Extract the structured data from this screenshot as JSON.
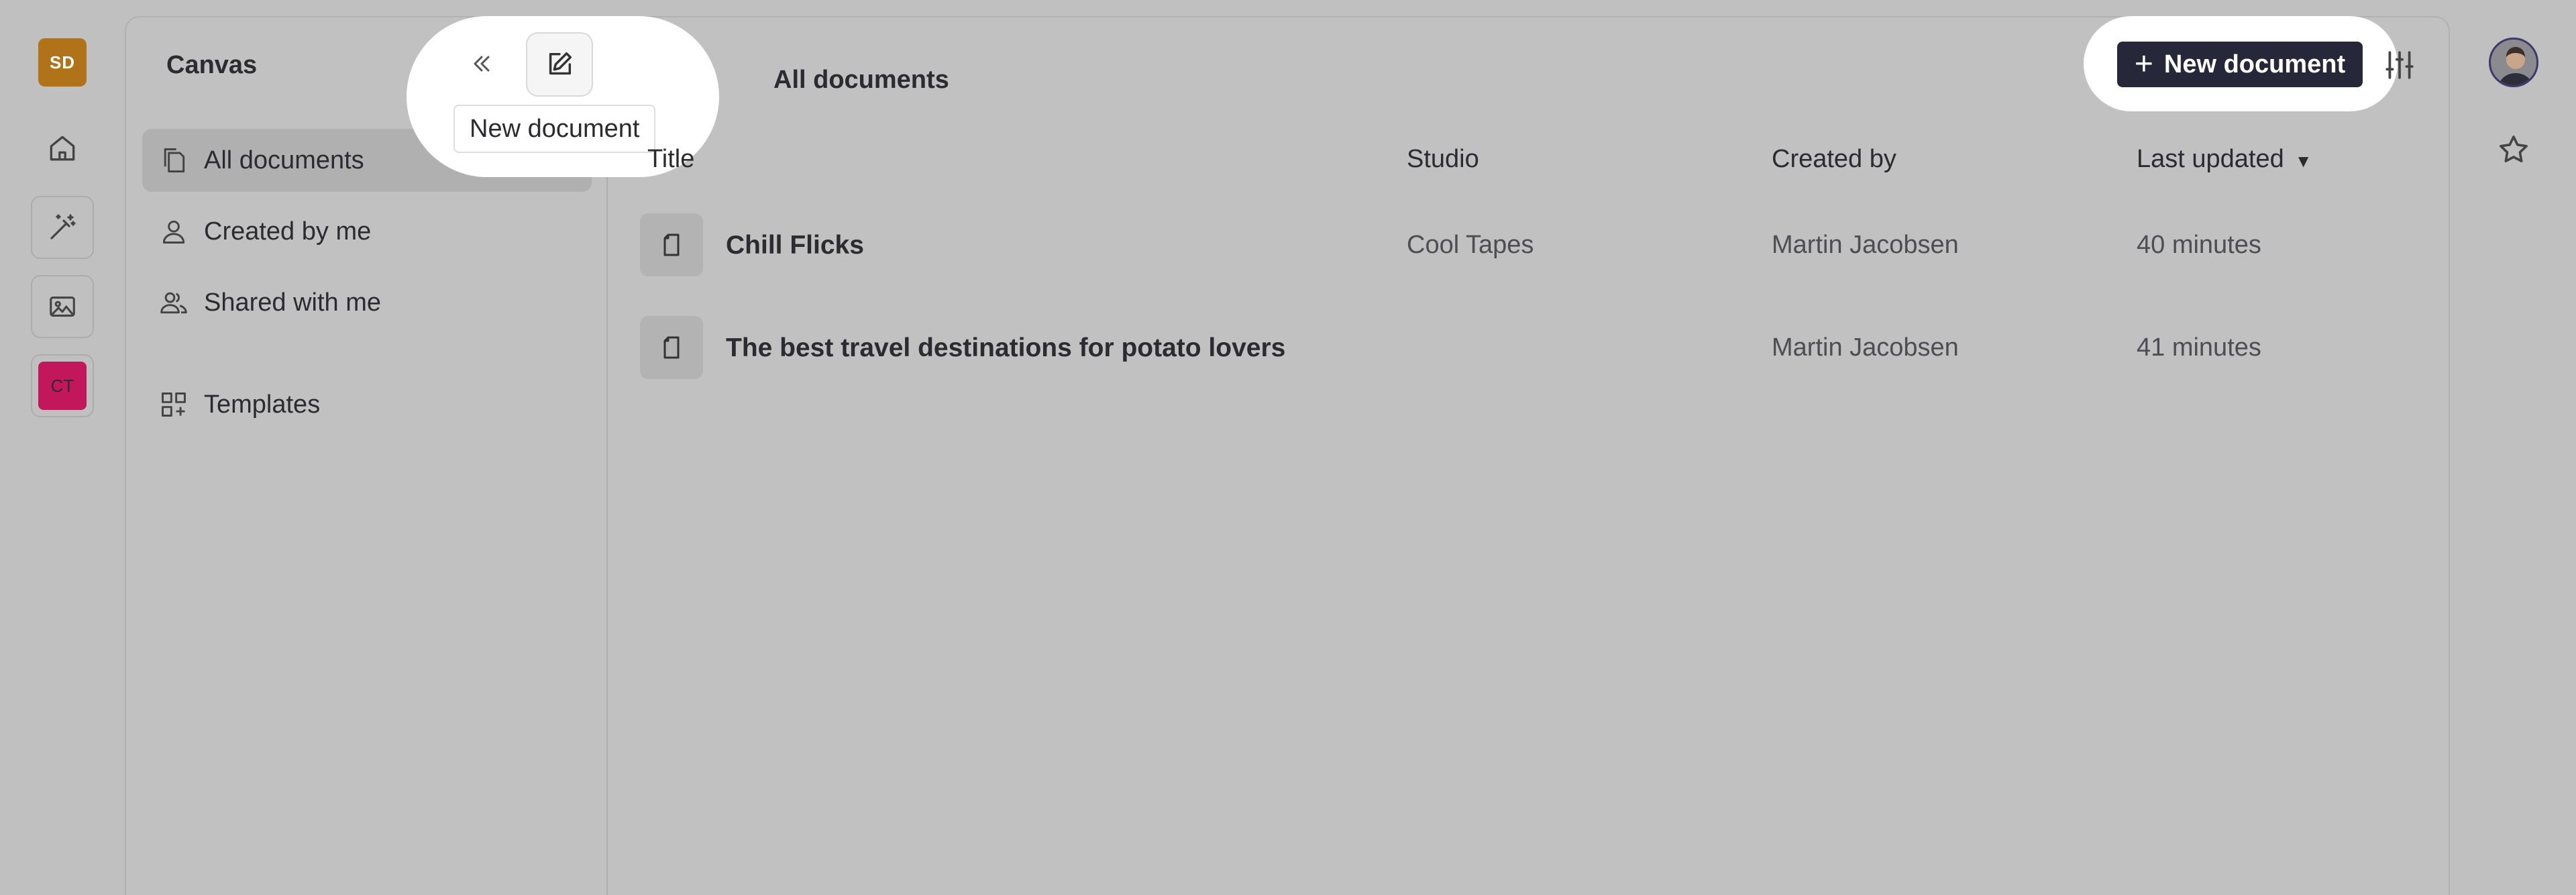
{
  "rail": {
    "workspace_initials": "SD",
    "workspace_color": "#b0731a",
    "studio_initials": "CT",
    "studio_color": "#c2185b"
  },
  "sidebar": {
    "app_title": "Canvas",
    "tooltip": "New document",
    "items": [
      {
        "label": "All documents",
        "icon": "documents-icon",
        "active": true
      },
      {
        "label": "Created by me",
        "icon": "user-icon",
        "active": false
      },
      {
        "label": "Shared with me",
        "icon": "users-icon",
        "active": false
      },
      {
        "label": "Templates",
        "icon": "templates-icon",
        "active": false
      }
    ]
  },
  "content": {
    "title": "All documents",
    "new_document_label": "New document",
    "columns": {
      "title": "Title",
      "studio": "Studio",
      "created_by": "Created by",
      "last_updated": "Last updated"
    },
    "rows": [
      {
        "title": "Chill Flicks",
        "studio": "Cool Tapes",
        "created_by": "Martin Jacobsen",
        "last_updated": "40 minutes"
      },
      {
        "title": "The best travel destinations for potato lovers",
        "studio": "",
        "created_by": "Martin Jacobsen",
        "last_updated": "41 minutes"
      }
    ]
  },
  "colors": {
    "overlay": "#c0c0c0",
    "primary_button": "#26283a",
    "highlight": "#ffffff"
  }
}
